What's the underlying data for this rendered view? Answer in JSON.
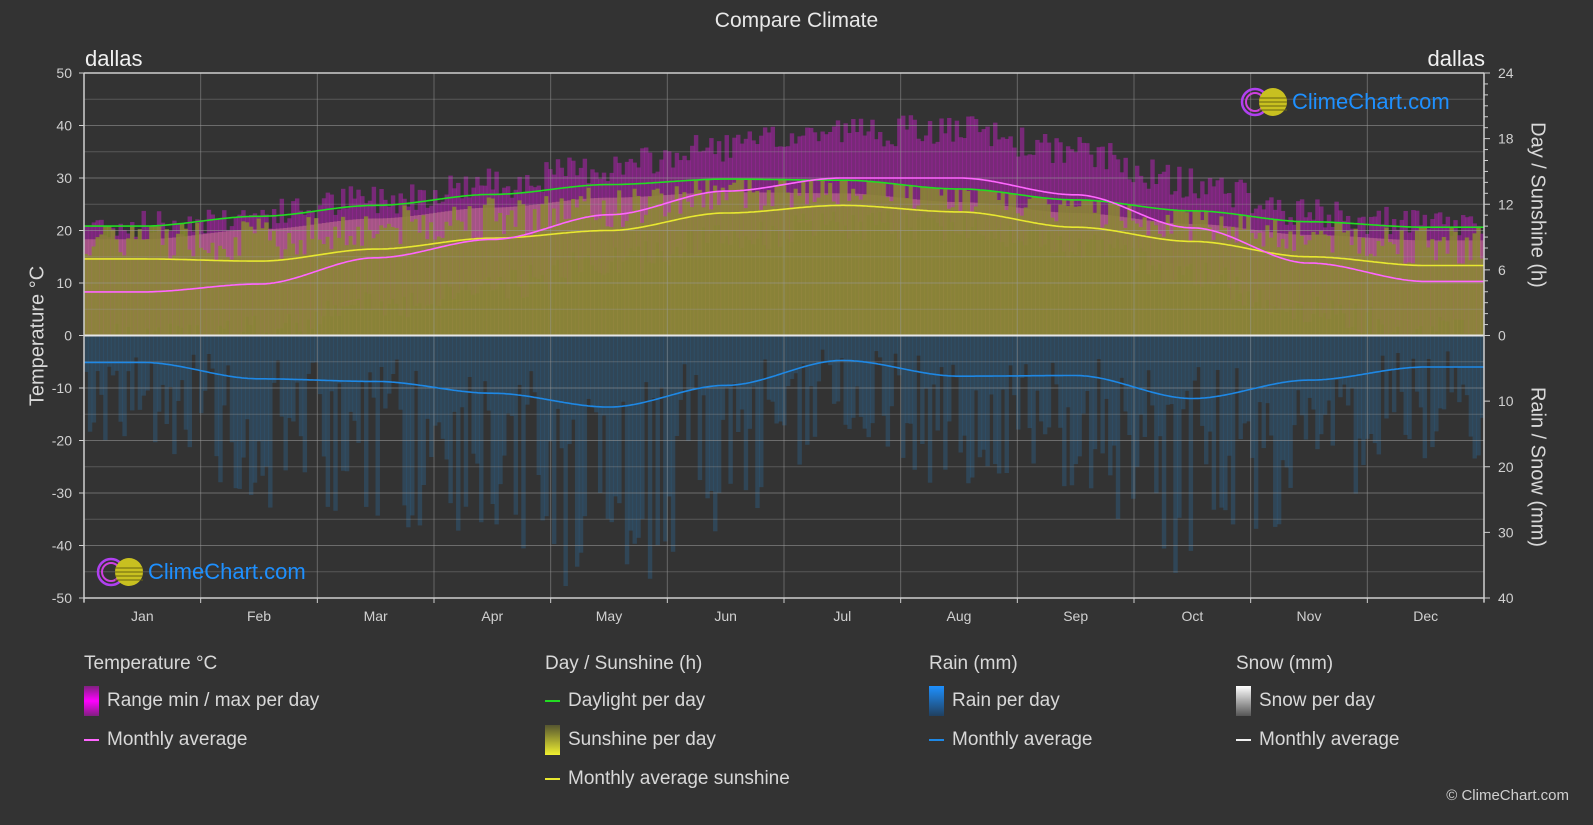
{
  "title": "Compare Climate",
  "city_left": "dallas",
  "city_right": "dallas",
  "logo_text": "ClimeChart.com",
  "copyright": "© ClimeChart.com",
  "legend": {
    "temperature": {
      "title": "Temperature °C",
      "items": [
        {
          "label": "Range min / max per day",
          "type": "gradient",
          "color": "#e020e0"
        },
        {
          "label": "Monthly average",
          "type": "line",
          "color": "#ff66ff"
        }
      ]
    },
    "sunshine": {
      "title": "Day / Sunshine (h)",
      "items": [
        {
          "label": "Daylight per day",
          "type": "line",
          "color": "#22dd22"
        },
        {
          "label": "Sunshine per day",
          "type": "gradient",
          "color": "#e8e830"
        },
        {
          "label": "Monthly average sunshine",
          "type": "line",
          "color": "#e8e830"
        }
      ]
    },
    "rain": {
      "title": "Rain (mm)",
      "items": [
        {
          "label": "Rain per day",
          "type": "gradient",
          "color": "#1e88e5"
        },
        {
          "label": "Monthly average",
          "type": "line",
          "color": "#1e88e5"
        }
      ]
    },
    "snow": {
      "title": "Snow (mm)",
      "items": [
        {
          "label": "Snow per day",
          "type": "gradient",
          "color": "#e0e0e0"
        },
        {
          "label": "Monthly average",
          "type": "line",
          "color": "#f0f0f0"
        }
      ]
    }
  },
  "chart_data": {
    "type": "line",
    "title": "Compare Climate",
    "categories": [
      "Jan",
      "Feb",
      "Mar",
      "Apr",
      "May",
      "Jun",
      "Jul",
      "Aug",
      "Sep",
      "Oct",
      "Nov",
      "Dec"
    ],
    "axes": {
      "left": {
        "label": "Temperature °C",
        "range": [
          -50,
          50
        ],
        "ticks": [
          50,
          40,
          30,
          20,
          10,
          0,
          -10,
          -20,
          -30,
          -40,
          -50
        ]
      },
      "right_top": {
        "label": "Day / Sunshine (h)",
        "range": [
          0,
          24
        ],
        "ticks": [
          24,
          18,
          12,
          6,
          0
        ]
      },
      "right_bottom": {
        "label": "Rain / Snow (mm)",
        "range": [
          0,
          40
        ],
        "ticks": [
          0,
          10,
          20,
          30,
          40
        ]
      }
    },
    "grid": true,
    "series": [
      {
        "name": "Temperature monthly average",
        "axis": "left",
        "unit": "°C",
        "color": "#ff66ff",
        "values": [
          8.3,
          9.8,
          14.8,
          18.3,
          23.0,
          27.5,
          30.0,
          30.0,
          26.8,
          20.5,
          13.8,
          10.3
        ]
      },
      {
        "name": "Temperature daily max (approx. band top)",
        "axis": "left",
        "unit": "°C",
        "color": "#a020a0",
        "values": [
          21,
          23,
          26,
          29,
          32,
          36,
          39,
          39,
          35,
          29,
          23,
          21
        ]
      },
      {
        "name": "Daylight per day",
        "axis": "right_top",
        "unit": "h",
        "color": "#22dd22",
        "values": [
          10.0,
          10.9,
          11.9,
          12.9,
          13.8,
          14.3,
          14.2,
          13.4,
          12.4,
          11.4,
          10.4,
          9.9
        ]
      },
      {
        "name": "Monthly average sunshine",
        "axis": "right_top",
        "unit": "h",
        "color": "#e8e830",
        "values": [
          7.0,
          6.8,
          7.9,
          8.9,
          9.6,
          11.2,
          11.9,
          11.3,
          9.9,
          8.6,
          7.2,
          6.4
        ]
      },
      {
        "name": "Rain monthly average",
        "axis": "right_bottom",
        "unit": "mm",
        "color": "#1e88e5",
        "values": [
          4.1,
          6.6,
          7.0,
          8.8,
          10.9,
          7.6,
          3.8,
          6.2,
          6.1,
          9.6,
          6.8,
          4.8
        ]
      },
      {
        "name": "Snow monthly average",
        "axis": "right_bottom",
        "unit": "mm",
        "color": "#f0f0f0",
        "values": [
          0,
          0,
          0,
          0,
          0,
          0,
          0,
          0,
          0,
          0,
          0,
          0
        ]
      }
    ]
  }
}
